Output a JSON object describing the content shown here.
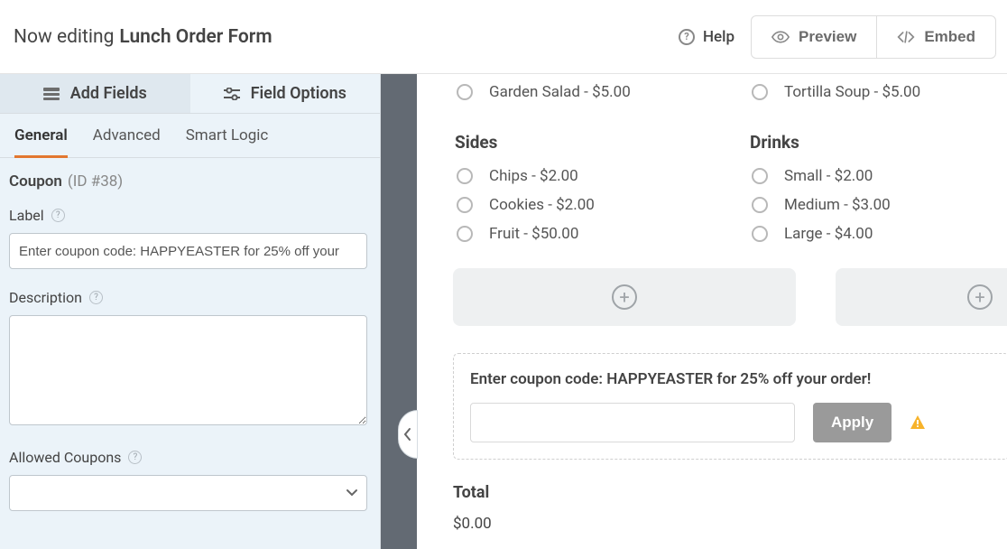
{
  "header": {
    "prefix": "Now editing",
    "title": "Lunch Order Form",
    "help": "Help",
    "preview": "Preview",
    "embed": "Embed"
  },
  "nav": {
    "add_fields": "Add Fields",
    "field_options": "Field Options"
  },
  "subnav": {
    "general": "General",
    "advanced": "Advanced",
    "smart_logic": "Smart Logic"
  },
  "panel": {
    "heading": "Coupon",
    "id_text": "(ID #38)",
    "label_label": "Label",
    "label_value": "Enter coupon code: HAPPYEASTER for 25% off your",
    "description_label": "Description",
    "description_value": "",
    "allowed_label": "Allowed Coupons",
    "allowed_value": ""
  },
  "preview": {
    "top_left_option": "Garden Salad - $5.00",
    "top_right_option": "Tortilla Soup - $5.00",
    "sides_title": "Sides",
    "sides": [
      "Chips - $2.00",
      "Cookies - $2.00",
      "Fruit - $50.00"
    ],
    "drinks_title": "Drinks",
    "drinks": [
      "Small - $2.00",
      "Medium - $3.00",
      "Large - $4.00"
    ],
    "coupon_heading": "Enter coupon code: HAPPYEASTER for 25% off your order!",
    "apply_label": "Apply",
    "total_label": "Total",
    "total_value": "$0.00"
  }
}
